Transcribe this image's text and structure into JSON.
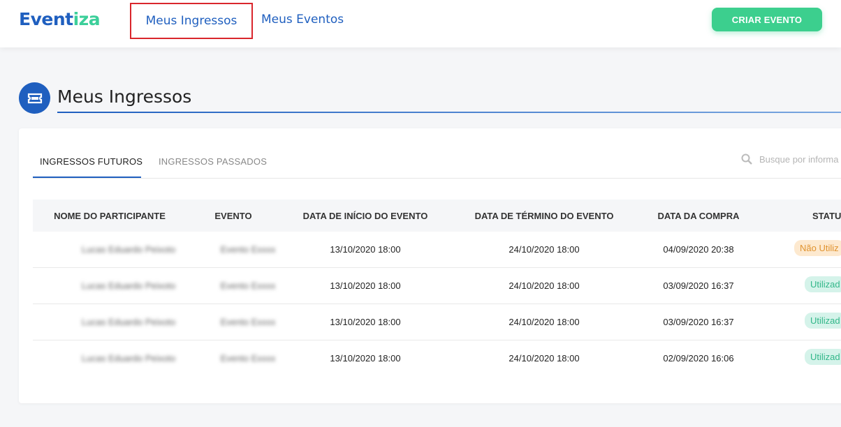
{
  "brand": {
    "part1": "Event",
    "part2": "iza"
  },
  "nav": {
    "tickets": "Meus Ingressos",
    "events": "Meus Eventos"
  },
  "create_button": "CRIAR EVENTO",
  "page_title": "Meus Ingressos",
  "tabs": {
    "future": "INGRESSOS FUTUROS",
    "past": "INGRESSOS PASSADOS"
  },
  "search": {
    "placeholder": "Busque por informa"
  },
  "table": {
    "headers": [
      "NOME DO PARTICIPANTE",
      "EVENTO",
      "DATA DE INÍCIO DO EVENTO",
      "DATA DE TÉRMINO DO EVENTO",
      "DATA DA COMPRA",
      "STATUS DO IN"
    ],
    "rows": [
      {
        "name": "Lucas Eduardo Peixoto",
        "event": "Evento Exxxx",
        "start": "13/10/2020 18:00",
        "end": "24/10/2020 18:00",
        "purchase": "04/09/2020 20:38",
        "status": "Não Utiliz"
      },
      {
        "name": "Lucas Eduardo Peixoto",
        "event": "Evento Exxxx",
        "start": "13/10/2020 18:00",
        "end": "24/10/2020 18:00",
        "purchase": "03/09/2020 16:37",
        "status": "Utilizad"
      },
      {
        "name": "Lucas Eduardo Peixoto",
        "event": "Evento Exxxx",
        "start": "13/10/2020 18:00",
        "end": "24/10/2020 18:00",
        "purchase": "03/09/2020 16:37",
        "status": "Utilizad"
      },
      {
        "name": "Lucas Eduardo Peixoto",
        "event": "Evento Exxxx",
        "start": "13/10/2020 18:00",
        "end": "24/10/2020 18:00",
        "purchase": "02/09/2020 16:06",
        "status": "Utilizad"
      }
    ]
  },
  "colors": {
    "primary": "#1f5fbf",
    "accent": "#3ccf8e",
    "highlight_box": "#d9262c"
  }
}
